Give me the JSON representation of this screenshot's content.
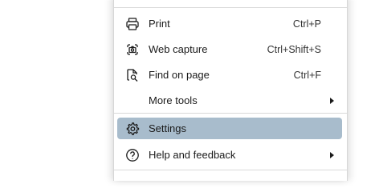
{
  "menu": {
    "items": [
      {
        "label": "Print",
        "shortcut": "Ctrl+P",
        "icon": "printer-icon"
      },
      {
        "label": "Web capture",
        "shortcut": "Ctrl+Shift+S",
        "icon": "web-capture-icon"
      },
      {
        "label": "Find on page",
        "shortcut": "Ctrl+F",
        "icon": "find-on-page-icon"
      },
      {
        "label": "More tools",
        "icon": "none"
      },
      {
        "label": "Settings",
        "icon": "gear-icon",
        "selected": true
      },
      {
        "label": "Help and feedback",
        "icon": "help-icon"
      }
    ]
  },
  "colors": {
    "selected_background": "#a8bccc",
    "divider": "#d9d9d9",
    "text": "#1a1a1a"
  }
}
